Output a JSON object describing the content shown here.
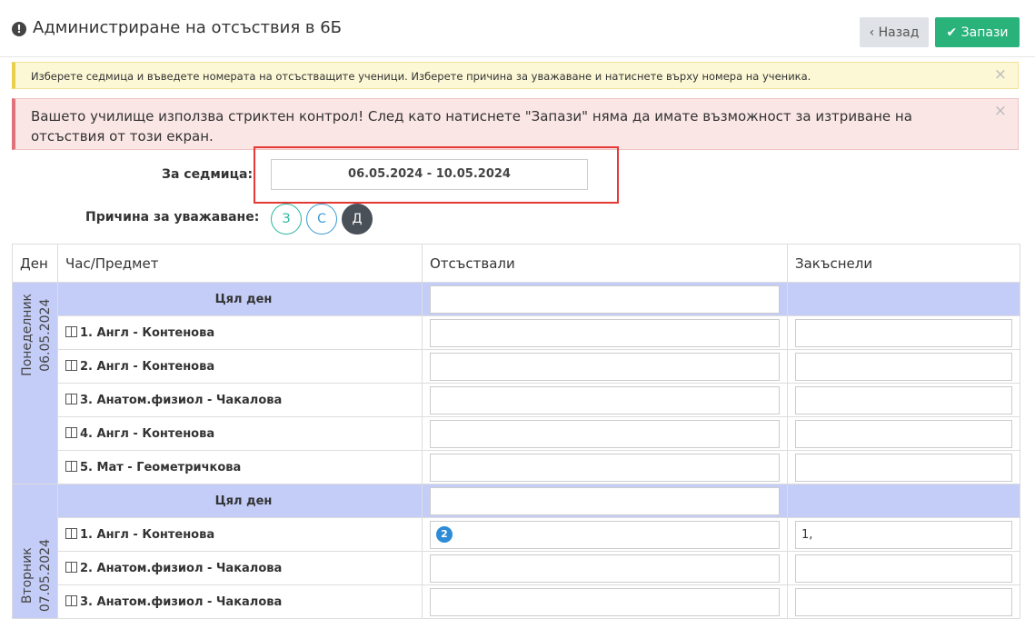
{
  "header": {
    "title": "Администриране на отсъствия в 6Б",
    "back_label": "Назад",
    "save_label": "Запази"
  },
  "alerts": {
    "info": "Изберете седмица и въведете номерата на отсъстващите ученици. Изберете причина за уважаване и натиснете върху номера на ученика.",
    "danger": "Вашето училище използва стриктен контрол! След като натиснете \"Запази\" няма да имате възможност за изтриване на отсъствия от този екран.",
    "close": "×"
  },
  "week": {
    "label": "За седмица:",
    "value": "06.05.2024 - 10.05.2024"
  },
  "reason": {
    "label": "Причина за уважаване:",
    "options": [
      "З",
      "С",
      "Д"
    ]
  },
  "table": {
    "headers": [
      "Ден",
      "Час/Предмет",
      "Отсъствали",
      "Закъснели"
    ],
    "full_day": "Цял ден",
    "days": [
      {
        "name": "Понеделник",
        "date": "06.05.2024",
        "lessons": [
          "1. Англ - Контенова",
          "2. Англ - Контенова",
          "3. Анатом.физиол - Чакалова",
          "4. Англ - Контенова",
          "5. Мат - Геометричкова"
        ]
      },
      {
        "name": "Вторник",
        "date": "07.05.2024",
        "lessons": [
          "1. Англ - Контенова",
          "2. Анатом.физиол - Чакалова",
          "3. Анатом.физиол - Чакалова"
        ],
        "absent_badge": "2",
        "late_value": "1,"
      }
    ]
  }
}
